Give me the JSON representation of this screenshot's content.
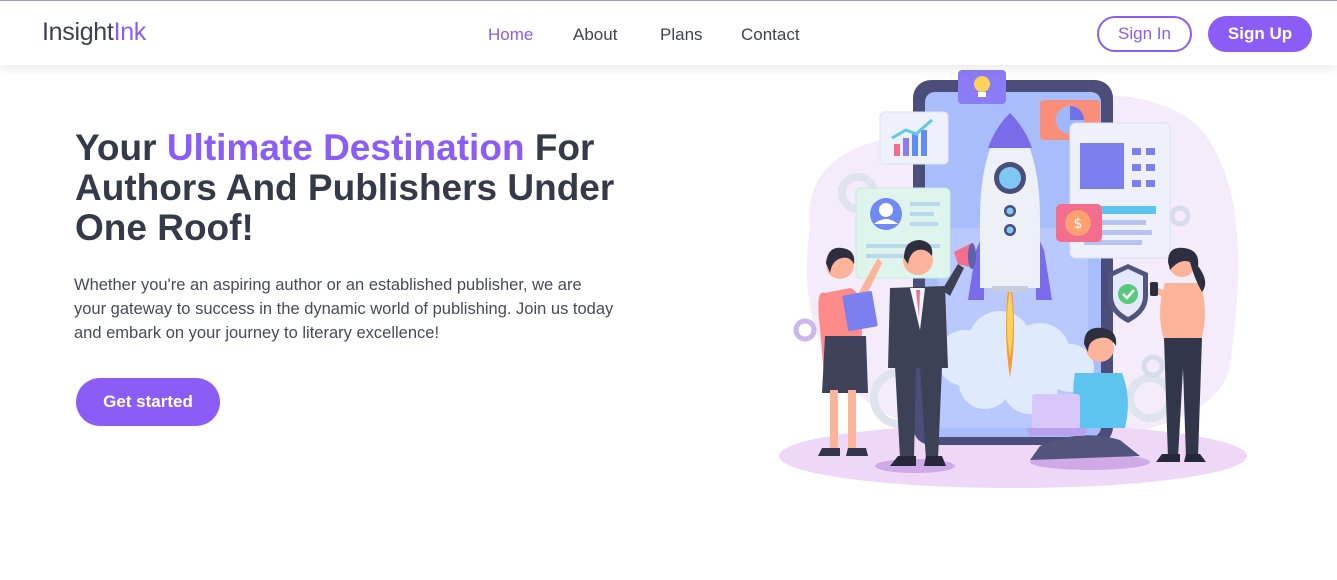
{
  "brand": {
    "name_part1": "Insight",
    "name_part2": "Ink",
    "accent_color": "#8b5cf6"
  },
  "nav": {
    "items": [
      {
        "label": "Home",
        "active": true
      },
      {
        "label": "About",
        "active": false
      },
      {
        "label": "Plans",
        "active": false
      },
      {
        "label": "Contact",
        "active": false
      }
    ]
  },
  "auth": {
    "sign_in": "Sign In",
    "sign_up": "Sign Up"
  },
  "hero": {
    "title_before": "Your ",
    "title_accent": "Ultimate Destination",
    "title_after": " For Authors And Publishers Under One Roof!",
    "description": "Whether you're an aspiring author or an established publisher, we are your gateway to success in the dynamic world of publishing. Join us today and embark on your journey to literary excellence!",
    "cta": "Get started"
  },
  "illustration": {
    "icons": [
      "lightbulb-icon",
      "bar-chart-icon",
      "pie-chart-icon",
      "profile-card-icon",
      "dollar-coin-icon",
      "shield-check-icon",
      "rocket-icon",
      "gear-icon",
      "megaphone-icon",
      "laptop-icon",
      "phone-icon"
    ]
  }
}
